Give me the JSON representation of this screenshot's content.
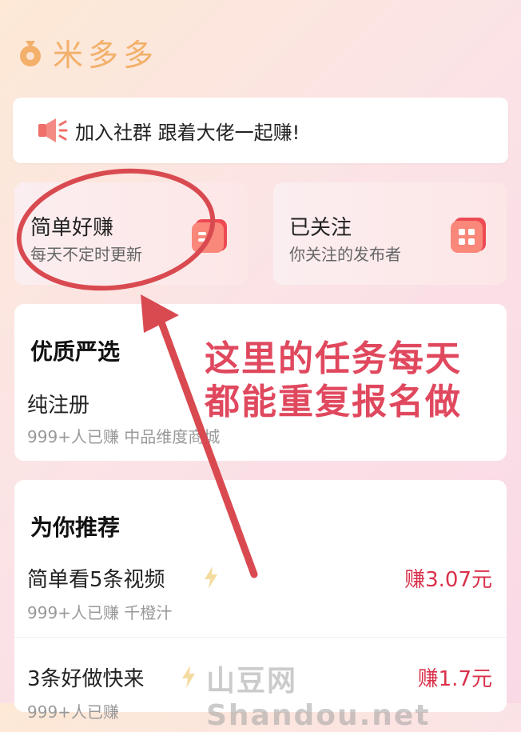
{
  "app": {
    "title": "米多多"
  },
  "banner": {
    "text": "加入社群  跟着大佬一起赚!"
  },
  "cards": [
    {
      "title": "简单好赚",
      "subtitle": "每天不定时更新",
      "icon": "task-icon"
    },
    {
      "title": "已关注",
      "subtitle": "你关注的发布者",
      "icon": "grid-icon"
    }
  ],
  "featured": {
    "title": "优质严选",
    "item": {
      "title": "纯注册",
      "meta": "999+人已赚   中品维度商城"
    }
  },
  "recommend": {
    "title": "为你推荐",
    "items": [
      {
        "title": "简单看5条视频",
        "meta": "999+人已赚   千橙汁",
        "reward": "赚3.07元"
      },
      {
        "title": "3条好做快来",
        "meta": "999+人已赚",
        "reward": "赚1.7元"
      }
    ]
  },
  "annotation": {
    "line1": "这里的任务每天",
    "line2": "都能重复报名做"
  },
  "watermark": "山豆网  Shandou.net",
  "colors": {
    "accent": "#d9314a",
    "brand": "#f2b06a",
    "annotation": "#e0485e"
  }
}
